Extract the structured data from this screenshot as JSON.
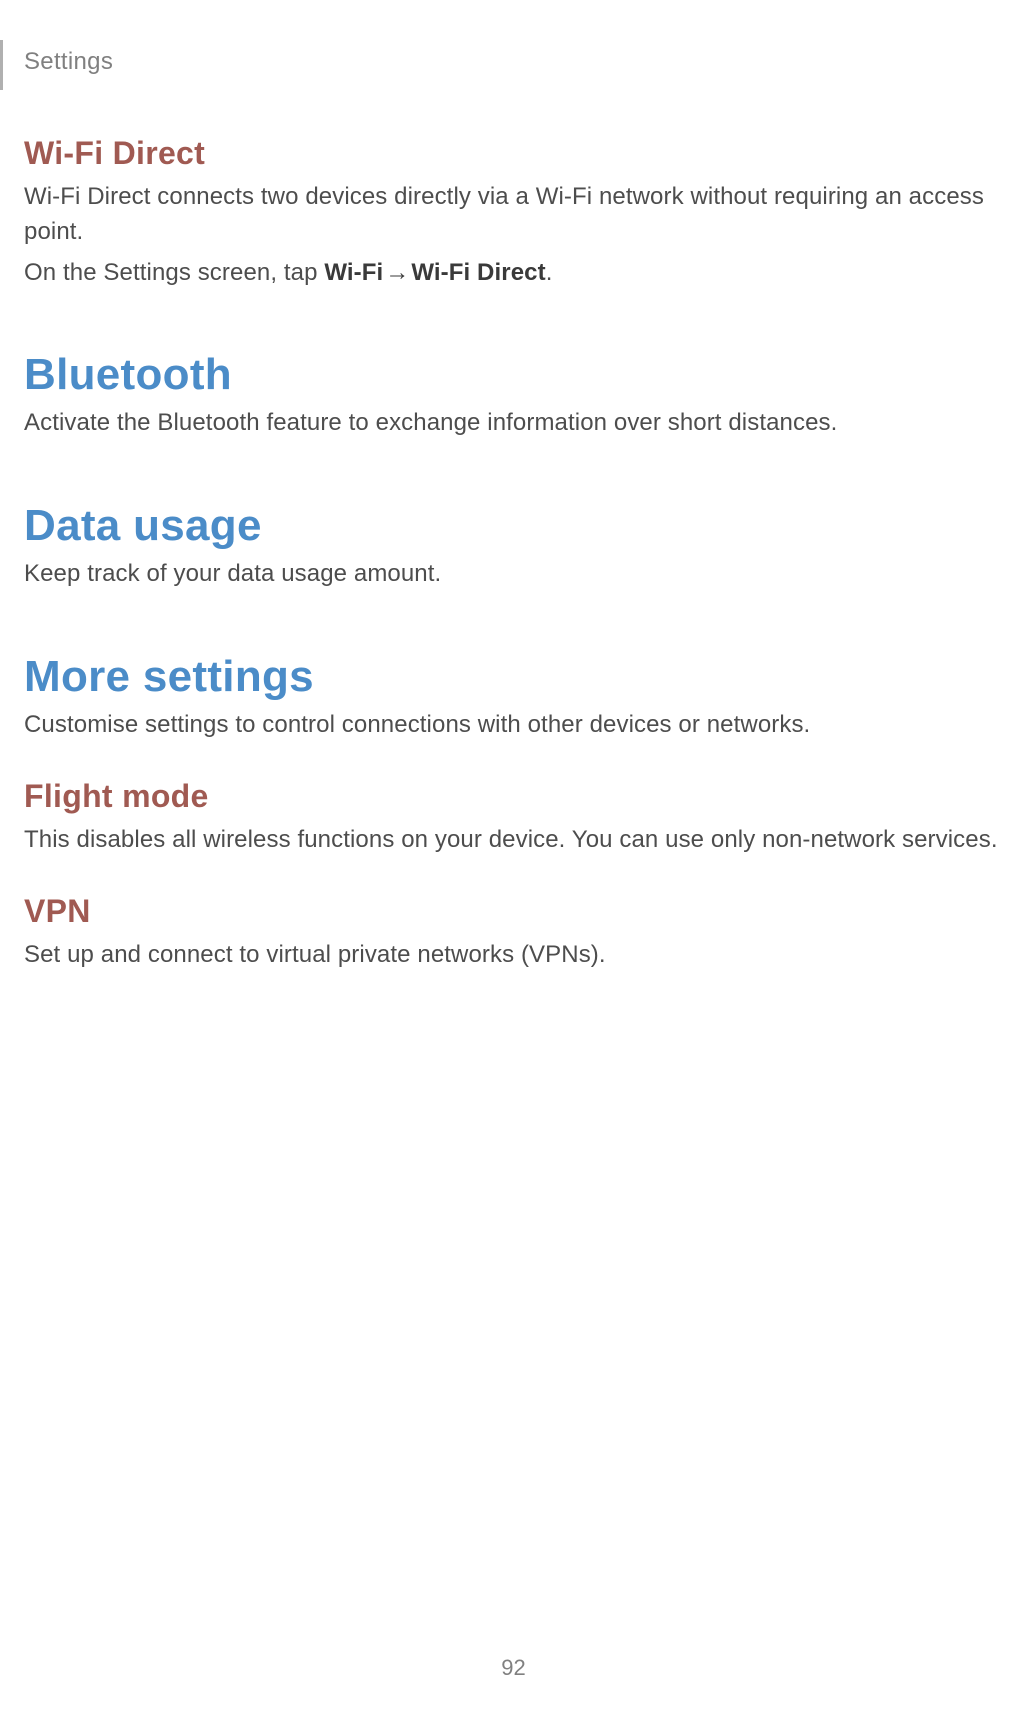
{
  "header": {
    "section_label": "Settings"
  },
  "sections": {
    "wifi_direct": {
      "title": "Wi-Fi Direct",
      "p1": "Wi-Fi Direct connects two devices directly via a Wi-Fi network without requiring an access point.",
      "p2_prefix": "On the Settings screen, tap ",
      "p2_bold1": "Wi-Fi",
      "p2_arrow": "→",
      "p2_bold2": "Wi-Fi Direct",
      "p2_suffix": "."
    },
    "bluetooth": {
      "title": "Bluetooth",
      "p1": "Activate the Bluetooth feature to exchange information over short distances."
    },
    "data_usage": {
      "title": "Data usage",
      "p1": "Keep track of your data usage amount."
    },
    "more_settings": {
      "title": "More settings",
      "p1": "Customise settings to control connections with other devices or networks."
    },
    "flight_mode": {
      "title": "Flight mode",
      "p1": "This disables all wireless functions on your device. You can use only non-network services."
    },
    "vpn": {
      "title": "VPN",
      "p1": "Set up and connect to virtual private networks (VPNs)."
    }
  },
  "page_number": "92"
}
